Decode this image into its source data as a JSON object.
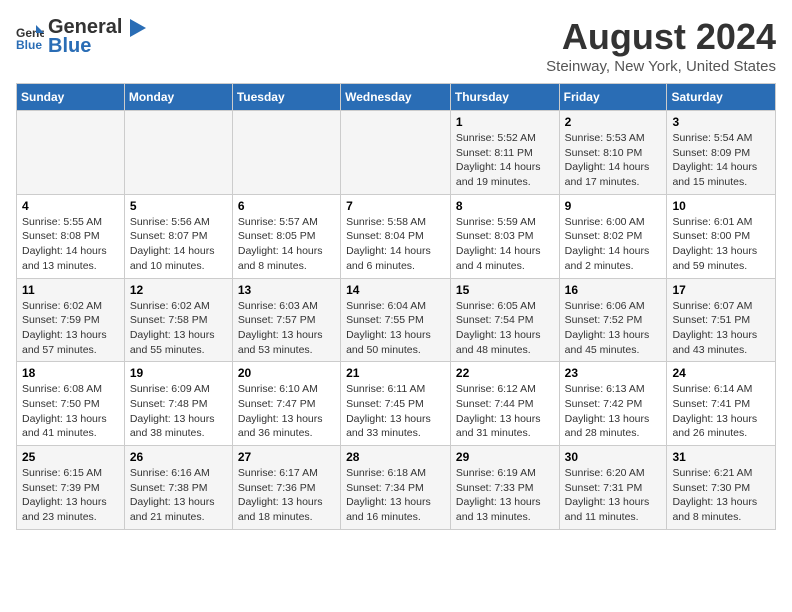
{
  "header": {
    "logo_general": "General",
    "logo_blue": "Blue",
    "main_title": "August 2024",
    "subtitle": "Steinway, New York, United States"
  },
  "weekdays": [
    "Sunday",
    "Monday",
    "Tuesday",
    "Wednesday",
    "Thursday",
    "Friday",
    "Saturday"
  ],
  "weeks": [
    [
      {
        "day": "",
        "info": ""
      },
      {
        "day": "",
        "info": ""
      },
      {
        "day": "",
        "info": ""
      },
      {
        "day": "",
        "info": ""
      },
      {
        "day": "1",
        "info": "Sunrise: 5:52 AM\nSunset: 8:11 PM\nDaylight: 14 hours\nand 19 minutes."
      },
      {
        "day": "2",
        "info": "Sunrise: 5:53 AM\nSunset: 8:10 PM\nDaylight: 14 hours\nand 17 minutes."
      },
      {
        "day": "3",
        "info": "Sunrise: 5:54 AM\nSunset: 8:09 PM\nDaylight: 14 hours\nand 15 minutes."
      }
    ],
    [
      {
        "day": "4",
        "info": "Sunrise: 5:55 AM\nSunset: 8:08 PM\nDaylight: 14 hours\nand 13 minutes."
      },
      {
        "day": "5",
        "info": "Sunrise: 5:56 AM\nSunset: 8:07 PM\nDaylight: 14 hours\nand 10 minutes."
      },
      {
        "day": "6",
        "info": "Sunrise: 5:57 AM\nSunset: 8:05 PM\nDaylight: 14 hours\nand 8 minutes."
      },
      {
        "day": "7",
        "info": "Sunrise: 5:58 AM\nSunset: 8:04 PM\nDaylight: 14 hours\nand 6 minutes."
      },
      {
        "day": "8",
        "info": "Sunrise: 5:59 AM\nSunset: 8:03 PM\nDaylight: 14 hours\nand 4 minutes."
      },
      {
        "day": "9",
        "info": "Sunrise: 6:00 AM\nSunset: 8:02 PM\nDaylight: 14 hours\nand 2 minutes."
      },
      {
        "day": "10",
        "info": "Sunrise: 6:01 AM\nSunset: 8:00 PM\nDaylight: 13 hours\nand 59 minutes."
      }
    ],
    [
      {
        "day": "11",
        "info": "Sunrise: 6:02 AM\nSunset: 7:59 PM\nDaylight: 13 hours\nand 57 minutes."
      },
      {
        "day": "12",
        "info": "Sunrise: 6:02 AM\nSunset: 7:58 PM\nDaylight: 13 hours\nand 55 minutes."
      },
      {
        "day": "13",
        "info": "Sunrise: 6:03 AM\nSunset: 7:57 PM\nDaylight: 13 hours\nand 53 minutes."
      },
      {
        "day": "14",
        "info": "Sunrise: 6:04 AM\nSunset: 7:55 PM\nDaylight: 13 hours\nand 50 minutes."
      },
      {
        "day": "15",
        "info": "Sunrise: 6:05 AM\nSunset: 7:54 PM\nDaylight: 13 hours\nand 48 minutes."
      },
      {
        "day": "16",
        "info": "Sunrise: 6:06 AM\nSunset: 7:52 PM\nDaylight: 13 hours\nand 45 minutes."
      },
      {
        "day": "17",
        "info": "Sunrise: 6:07 AM\nSunset: 7:51 PM\nDaylight: 13 hours\nand 43 minutes."
      }
    ],
    [
      {
        "day": "18",
        "info": "Sunrise: 6:08 AM\nSunset: 7:50 PM\nDaylight: 13 hours\nand 41 minutes."
      },
      {
        "day": "19",
        "info": "Sunrise: 6:09 AM\nSunset: 7:48 PM\nDaylight: 13 hours\nand 38 minutes."
      },
      {
        "day": "20",
        "info": "Sunrise: 6:10 AM\nSunset: 7:47 PM\nDaylight: 13 hours\nand 36 minutes."
      },
      {
        "day": "21",
        "info": "Sunrise: 6:11 AM\nSunset: 7:45 PM\nDaylight: 13 hours\nand 33 minutes."
      },
      {
        "day": "22",
        "info": "Sunrise: 6:12 AM\nSunset: 7:44 PM\nDaylight: 13 hours\nand 31 minutes."
      },
      {
        "day": "23",
        "info": "Sunrise: 6:13 AM\nSunset: 7:42 PM\nDaylight: 13 hours\nand 28 minutes."
      },
      {
        "day": "24",
        "info": "Sunrise: 6:14 AM\nSunset: 7:41 PM\nDaylight: 13 hours\nand 26 minutes."
      }
    ],
    [
      {
        "day": "25",
        "info": "Sunrise: 6:15 AM\nSunset: 7:39 PM\nDaylight: 13 hours\nand 23 minutes."
      },
      {
        "day": "26",
        "info": "Sunrise: 6:16 AM\nSunset: 7:38 PM\nDaylight: 13 hours\nand 21 minutes."
      },
      {
        "day": "27",
        "info": "Sunrise: 6:17 AM\nSunset: 7:36 PM\nDaylight: 13 hours\nand 18 minutes."
      },
      {
        "day": "28",
        "info": "Sunrise: 6:18 AM\nSunset: 7:34 PM\nDaylight: 13 hours\nand 16 minutes."
      },
      {
        "day": "29",
        "info": "Sunrise: 6:19 AM\nSunset: 7:33 PM\nDaylight: 13 hours\nand 13 minutes."
      },
      {
        "day": "30",
        "info": "Sunrise: 6:20 AM\nSunset: 7:31 PM\nDaylight: 13 hours\nand 11 minutes."
      },
      {
        "day": "31",
        "info": "Sunrise: 6:21 AM\nSunset: 7:30 PM\nDaylight: 13 hours\nand 8 minutes."
      }
    ]
  ]
}
